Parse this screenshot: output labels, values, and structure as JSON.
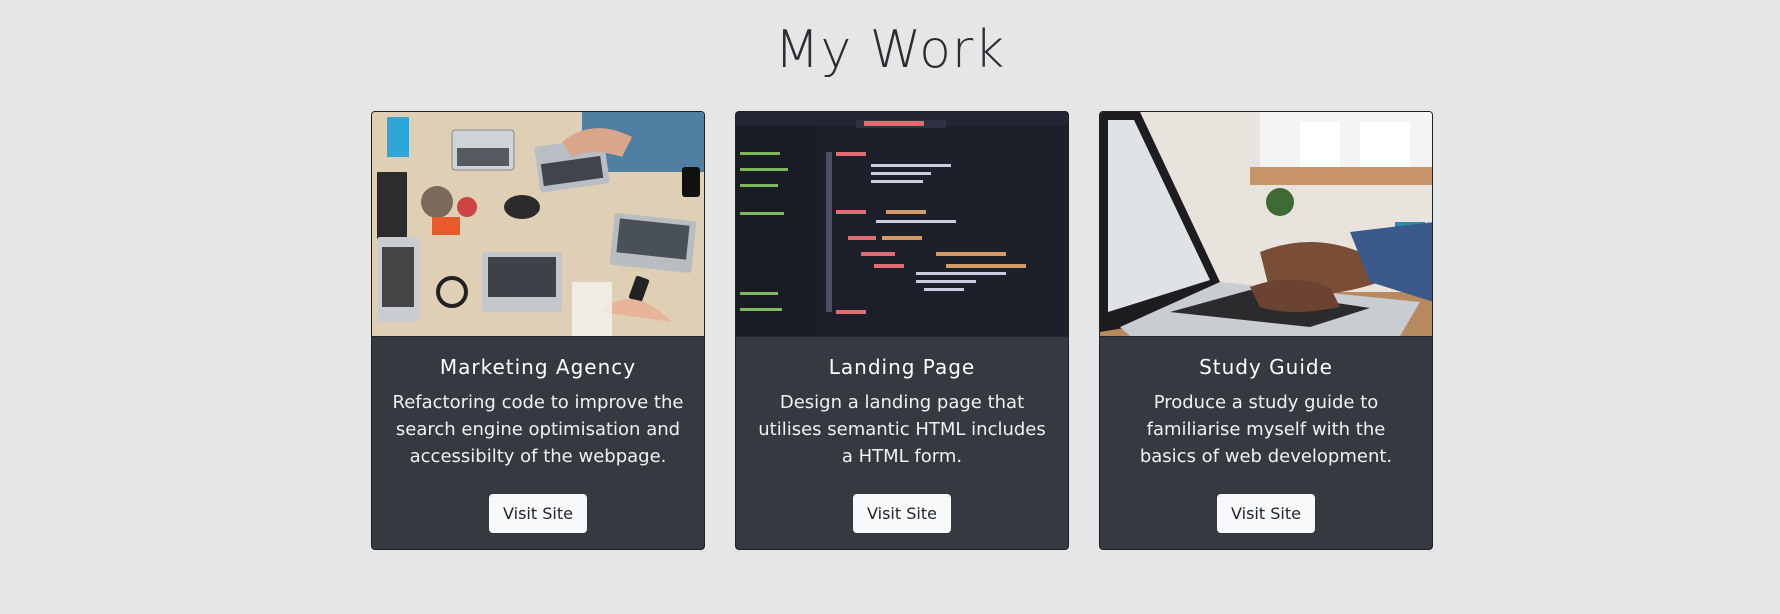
{
  "page": {
    "title": "My Work"
  },
  "projects": [
    {
      "title": "Marketing Agency",
      "description": "Refactoring code to improve the search engine optimisation and accessibilty of the webpage.",
      "button_label": "Visit Site",
      "image_alt": "team-desk-photo"
    },
    {
      "title": "Landing Page",
      "description": "Design a landing page that utilises semantic HTML includes a HTML form.",
      "button_label": "Visit Site",
      "image_alt": "code-editor-screenshot"
    },
    {
      "title": "Study Guide",
      "description": "Produce a study guide to familiarise myself with the basics of web development.",
      "button_label": "Visit Site",
      "image_alt": "laptop-typing-photo"
    }
  ],
  "colors": {
    "background": "#e6e6e6",
    "card": "#343a40",
    "button": "#f8f9fa"
  }
}
